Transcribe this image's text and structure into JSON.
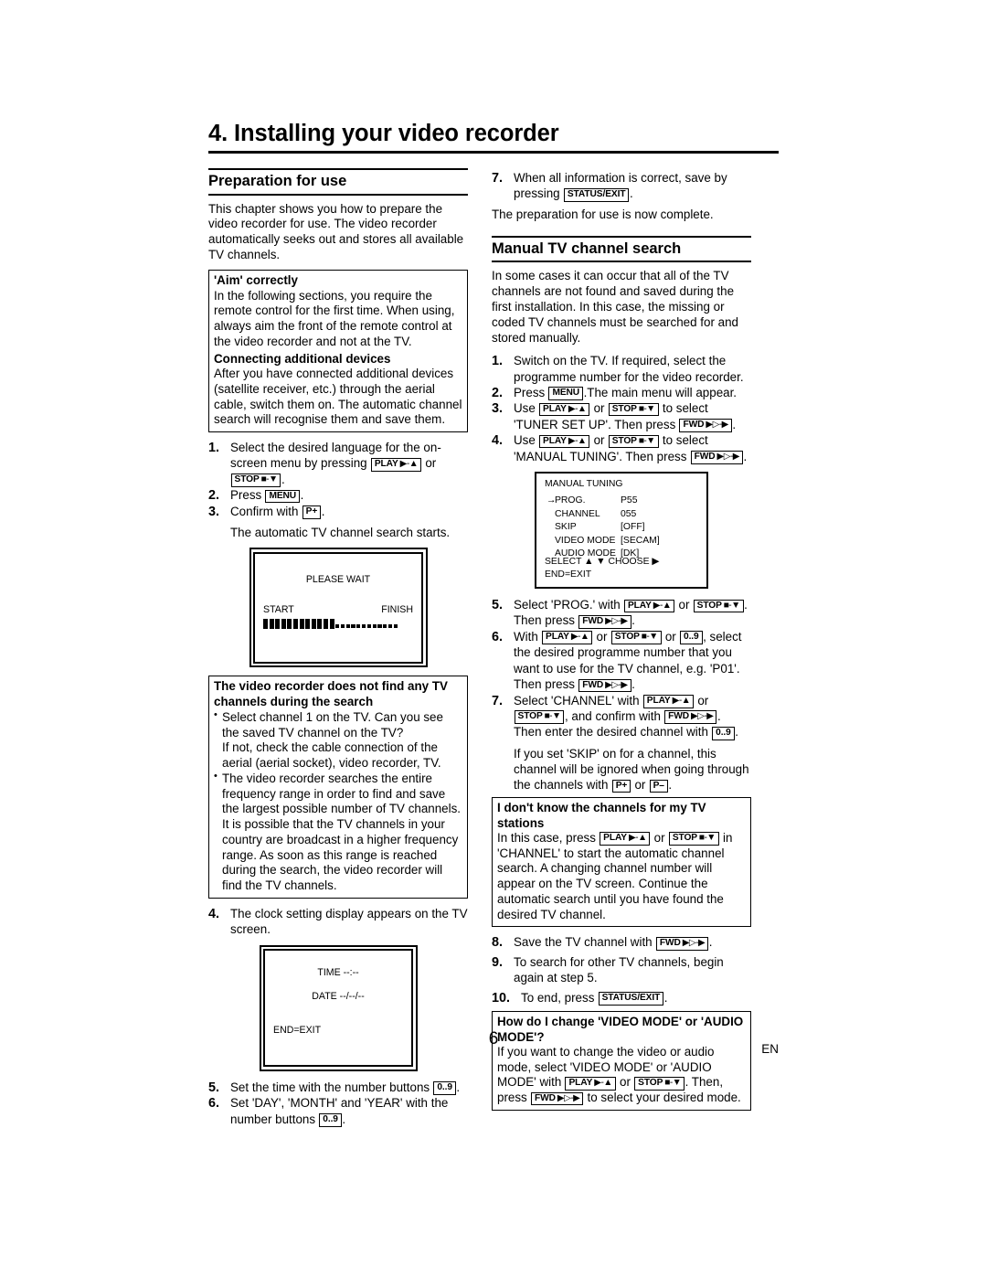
{
  "document": {
    "chapter_title": "4. Installing your video recorder",
    "page_number": "6",
    "language_code": "EN"
  },
  "keys": {
    "play": "PLAY",
    "play_glyph": "▶-▲",
    "stop": "STOP",
    "stop_glyph": "■-▼",
    "fwd": "FWD",
    "fwd_glyph": "▶▷-▶",
    "menu": "MENU",
    "status_exit": "STATUS/EXIT",
    "p_plus": "P+",
    "p_minus": "P–",
    "numbers": "0..9"
  },
  "left_column": {
    "section_title": "Preparation for use",
    "intro": "This chapter shows you how to prepare the video recorder for use. The video recorder automatically seeks out and stores all available TV channels.",
    "note_aim": {
      "title": "'Aim' correctly",
      "body": "In the following sections, you require the remote control for the first time. When using, always aim the front of the remote control at the video recorder and not at the TV.",
      "title2": "Connecting additional devices",
      "body2": "After you have connected additional devices (satellite receiver, etc.) through the aerial cable, switch them on. The automatic channel search will recognise them and save them."
    },
    "steps": [
      {
        "num": "1.",
        "text_before": "Select the desired language for the on-screen menu by pressing ",
        "between": " or ",
        "text_after": "."
      },
      {
        "num": "2.",
        "text_before": "Press ",
        "text_after": "."
      },
      {
        "num": "3.",
        "text_before": "Confirm with ",
        "text_after": "."
      }
    ],
    "after_step3": "The automatic TV channel search starts.",
    "screen_please_wait": {
      "title": "PLEASE WAIT",
      "start_label": "START",
      "finish_label": "FINISH",
      "filled_blocks": 12,
      "empty_dots": 12
    },
    "note_notfound": {
      "title": "The video recorder does not find any TV channels during the search",
      "bullet1": "Select channel 1 on the TV. Can you see the saved TV channel on the TV?",
      "bullet1_extra": "If not, check the cable connection of the aerial (aerial socket), video recorder, TV.",
      "bullet2": "The video recorder searches the entire frequency range in order to find and save the largest possible number of TV channels. It is possible that the TV channels in your country are broadcast in a higher frequency range. As soon as this range is reached during the search, the video recorder will find the TV channels."
    },
    "step4": {
      "num": "4.",
      "text": "The clock setting display appears on the TV screen."
    },
    "screen_clock": {
      "time_label": "TIME --:--",
      "date_label": "DATE --/--/--",
      "end_label": "END=EXIT"
    },
    "step5": {
      "num": "5.",
      "text_before": "Set the time with the number buttons ",
      "text_after": "."
    },
    "step6": {
      "num": "6.",
      "text_before": "Set 'DAY', 'MONTH' and 'YEAR' with the number buttons ",
      "text_after": "."
    }
  },
  "right_column": {
    "step7": {
      "num": "7.",
      "text_before": "When all information is correct, save by pressing ",
      "text_after": "."
    },
    "after_step7": "The preparation for use is now complete.",
    "section_title": "Manual TV channel search",
    "intro": "In some cases it can occur that all of the TV channels are not found and saved during the first installation. In this case, the missing or coded TV channels must be searched for and stored manually.",
    "step1": {
      "num": "1.",
      "text": "Switch on the TV. If required, select the programme number for the video recorder."
    },
    "step2": {
      "num": "2.",
      "text_before": "Press ",
      "text_after": ".The main menu will appear."
    },
    "step3": {
      "num": "3.",
      "pre": "Use ",
      "mid": " or ",
      "post": " to select 'TUNER SET UP'. Then press ",
      "end": "."
    },
    "step4": {
      "num": "4.",
      "pre": "Use ",
      "mid": " or ",
      "post": " to select 'MANUAL TUNING'. Then press ",
      "end": "."
    },
    "menu_screen": {
      "title": "MANUAL TUNING",
      "rows": [
        {
          "label": "PROG.",
          "value": "P55",
          "selected": true
        },
        {
          "label": "CHANNEL",
          "value": "055",
          "selected": false
        },
        {
          "label": "SKIP",
          "value": "[OFF]",
          "selected": false
        },
        {
          "label": "VIDEO MODE",
          "value": "[SECAM]",
          "selected": false
        },
        {
          "label": "AUDIO MODE",
          "value": "[DK]",
          "selected": false
        }
      ],
      "footer_line1": "SELECT ▲ ▼  CHOOSE ▶",
      "footer_line2": "END=EXIT"
    },
    "step5": {
      "num": "5.",
      "pre": "Select 'PROG.' with ",
      "mid": " or ",
      "post": ". Then press ",
      "end": "."
    },
    "step6": {
      "num": "6.",
      "pre": "With ",
      "mid": " or ",
      "mid2": " or ",
      "post": ", select the desired programme number that you want to use for the TV channel, e.g. 'P01'. Then press ",
      "end": "."
    },
    "step7b": {
      "num": "7.",
      "pre": "Select 'CHANNEL' with ",
      "mid": " or ",
      "post": ", and confirm with ",
      "post2": ". Then enter the desired channel with ",
      "end": "."
    },
    "step7b_extra": {
      "pre": "If you set 'SKIP' on for a channel, this channel will be ignored when going through the channels with ",
      "mid": " or ",
      "end": "."
    },
    "note_unknown": {
      "title": "I don't know the channels for my TV stations",
      "pre": "In this case, press ",
      "mid": " or ",
      "post": " in 'CHANNEL' to start the automatic channel search. A changing channel number will appear on the TV screen. Continue the automatic search until you have found the desired TV channel."
    },
    "step8": {
      "num": "8.",
      "text_before": "Save the TV channel with ",
      "text_after": "."
    },
    "step9": {
      "num": "9.",
      "text": "To search for other TV channels, begin again at step 5."
    },
    "step10": {
      "num": "10.",
      "text_before": "To end, press ",
      "text_after": "."
    },
    "note_mode": {
      "title": "How do I change 'VIDEO MODE' or 'AUDIO MODE'?",
      "pre": "If you want to change the video or audio mode, select 'VIDEO MODE' or 'AUDIO MODE' with ",
      "mid": " or ",
      "post": ". Then, press ",
      "end": " to select your desired mode."
    }
  }
}
